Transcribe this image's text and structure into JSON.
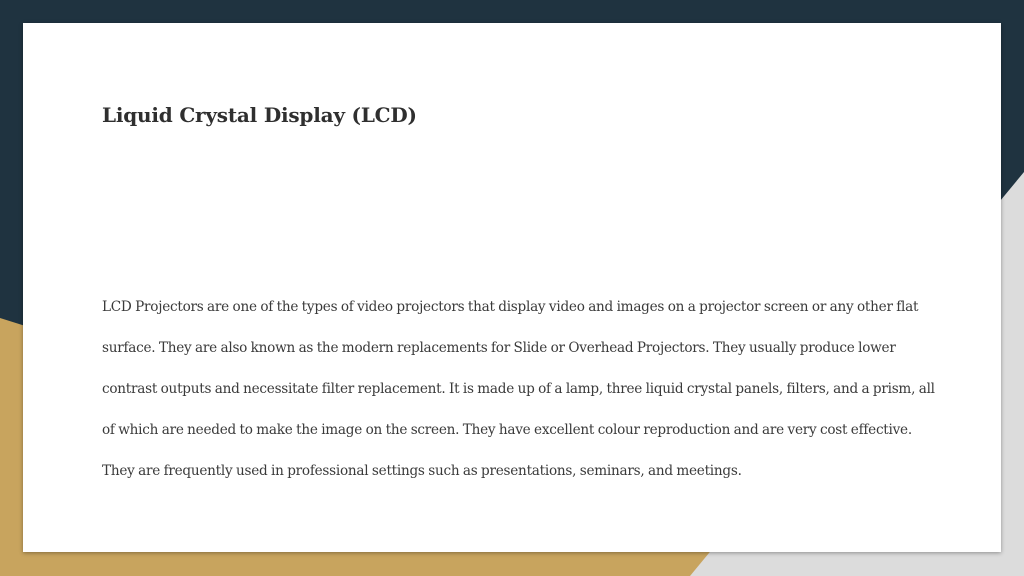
{
  "slide": {
    "title": "Liquid Crystal Display (LCD)",
    "body": "LCD Projectors are one of the types of video projectors that display video and images on a projector screen or any other flat surface. They are also known as the modern replacements for Slide or Overhead Projectors. They usually produce lower contrast outputs and necessitate filter replacement. It is made up of a lamp, three liquid crystal panels, filters, and a prism, all of which are needed to make the image on the screen. They have excellent colour reproduction and are very cost effective. They are frequently used in professional settings such as presentations, seminars, and meetings."
  },
  "theme": {
    "background_dark": "#1f3340",
    "accent_gold": "#c8a45e",
    "accent_light_gray": "#dcdcdc",
    "card": "#ffffff"
  }
}
